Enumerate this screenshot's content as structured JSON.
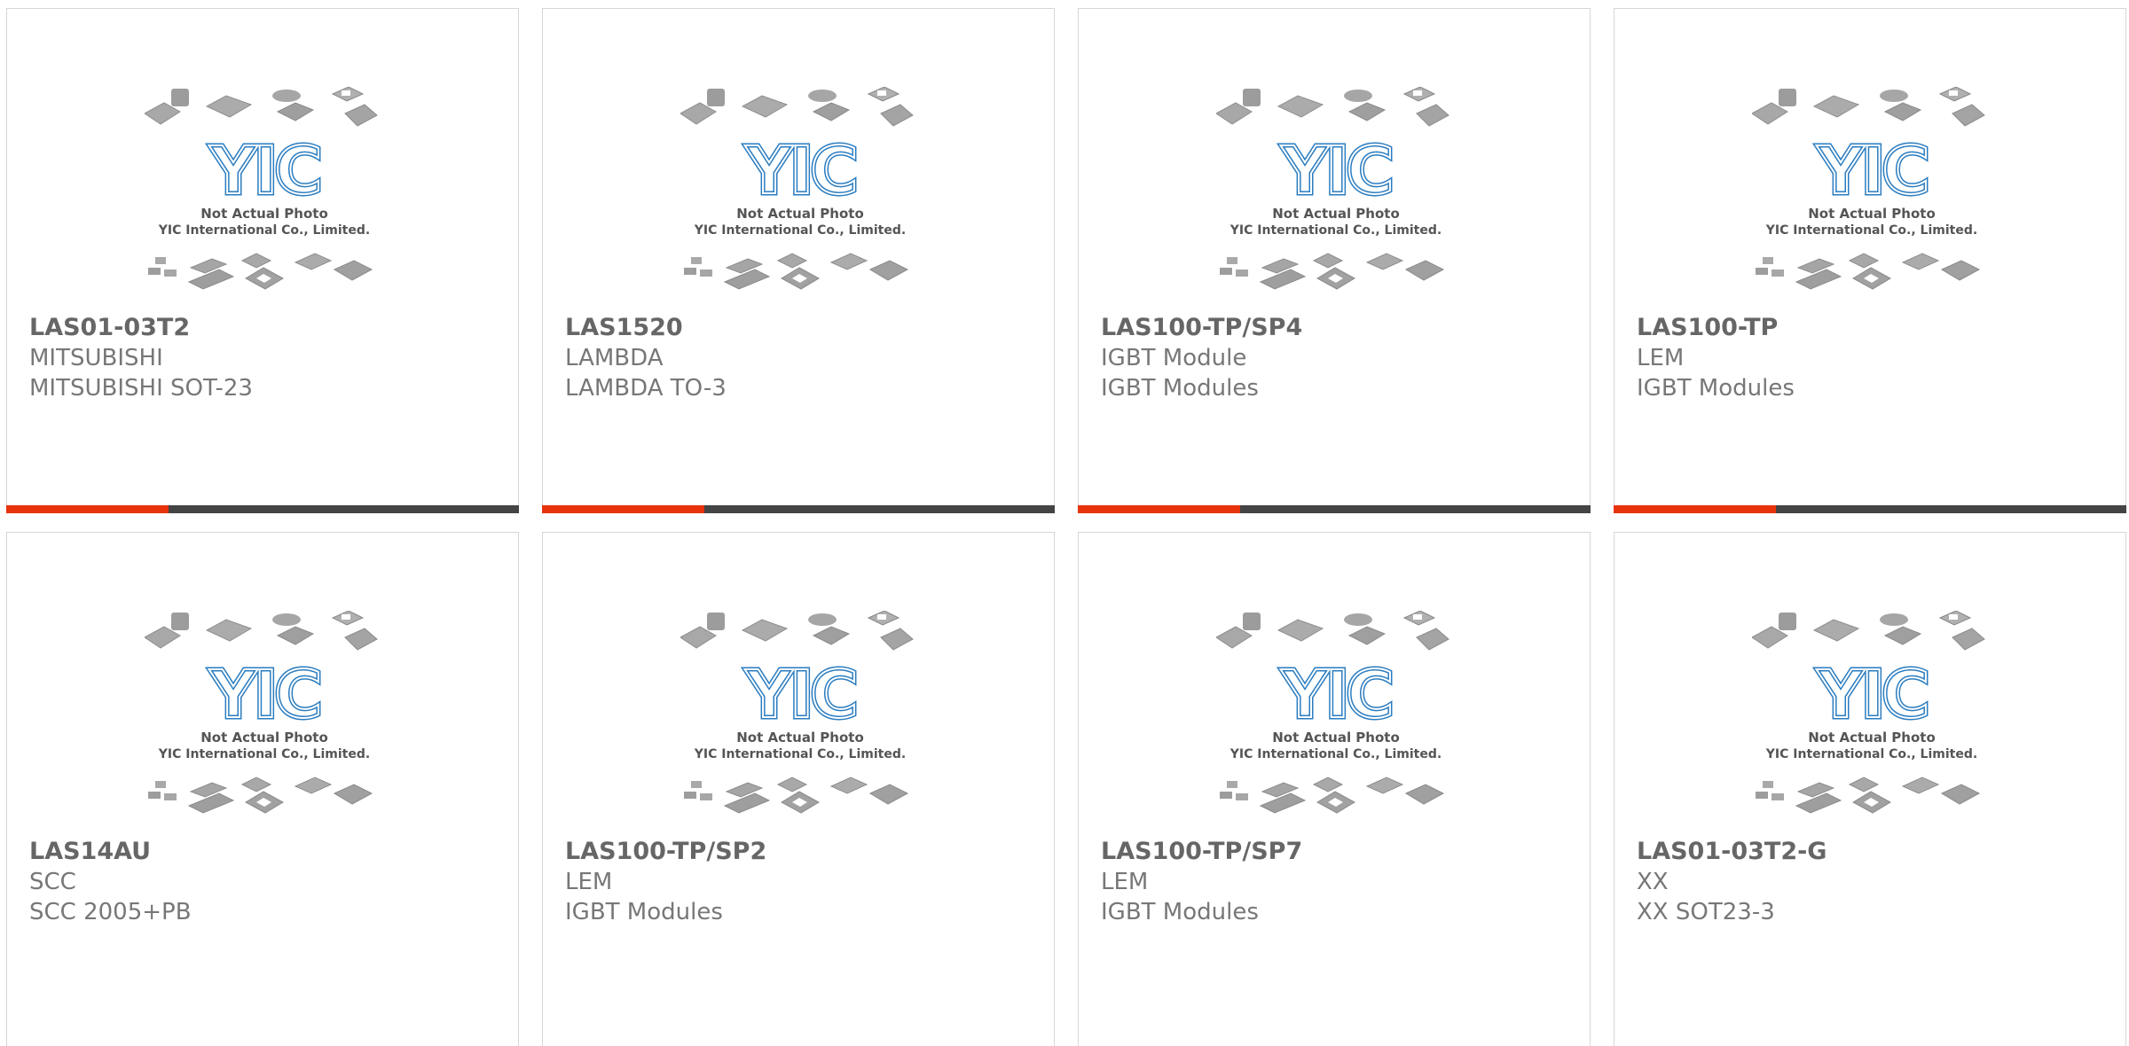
{
  "placeholder": {
    "logo_text": "YIC",
    "note_line1": "Not Actual Photo",
    "note_line2": "YIC International Co., Limited."
  },
  "colors": {
    "accent": "#e8320b",
    "bar": "#444444",
    "logo": "#2a7cc0"
  },
  "products": [
    {
      "part_number": "LAS01-03T2",
      "manufacturer": "MITSUBISHI",
      "description": "MITSUBISHI SOT-23"
    },
    {
      "part_number": "LAS1520",
      "manufacturer": "LAMBDA",
      "description": "LAMBDA TO-3"
    },
    {
      "part_number": "LAS100-TP/SP4",
      "manufacturer": "IGBT Module",
      "description": "IGBT Modules"
    },
    {
      "part_number": "LAS100-TP",
      "manufacturer": "LEM",
      "description": "IGBT Modules"
    },
    {
      "part_number": "LAS14AU",
      "manufacturer": "SCC",
      "description": "SCC 2005+PB"
    },
    {
      "part_number": "LAS100-TP/SP2",
      "manufacturer": "LEM",
      "description": "IGBT Modules"
    },
    {
      "part_number": "LAS100-TP/SP7",
      "manufacturer": "LEM",
      "description": "IGBT Modules"
    },
    {
      "part_number": "LAS01-03T2-G",
      "manufacturer": "XX",
      "description": "XX SOT23-3"
    }
  ]
}
